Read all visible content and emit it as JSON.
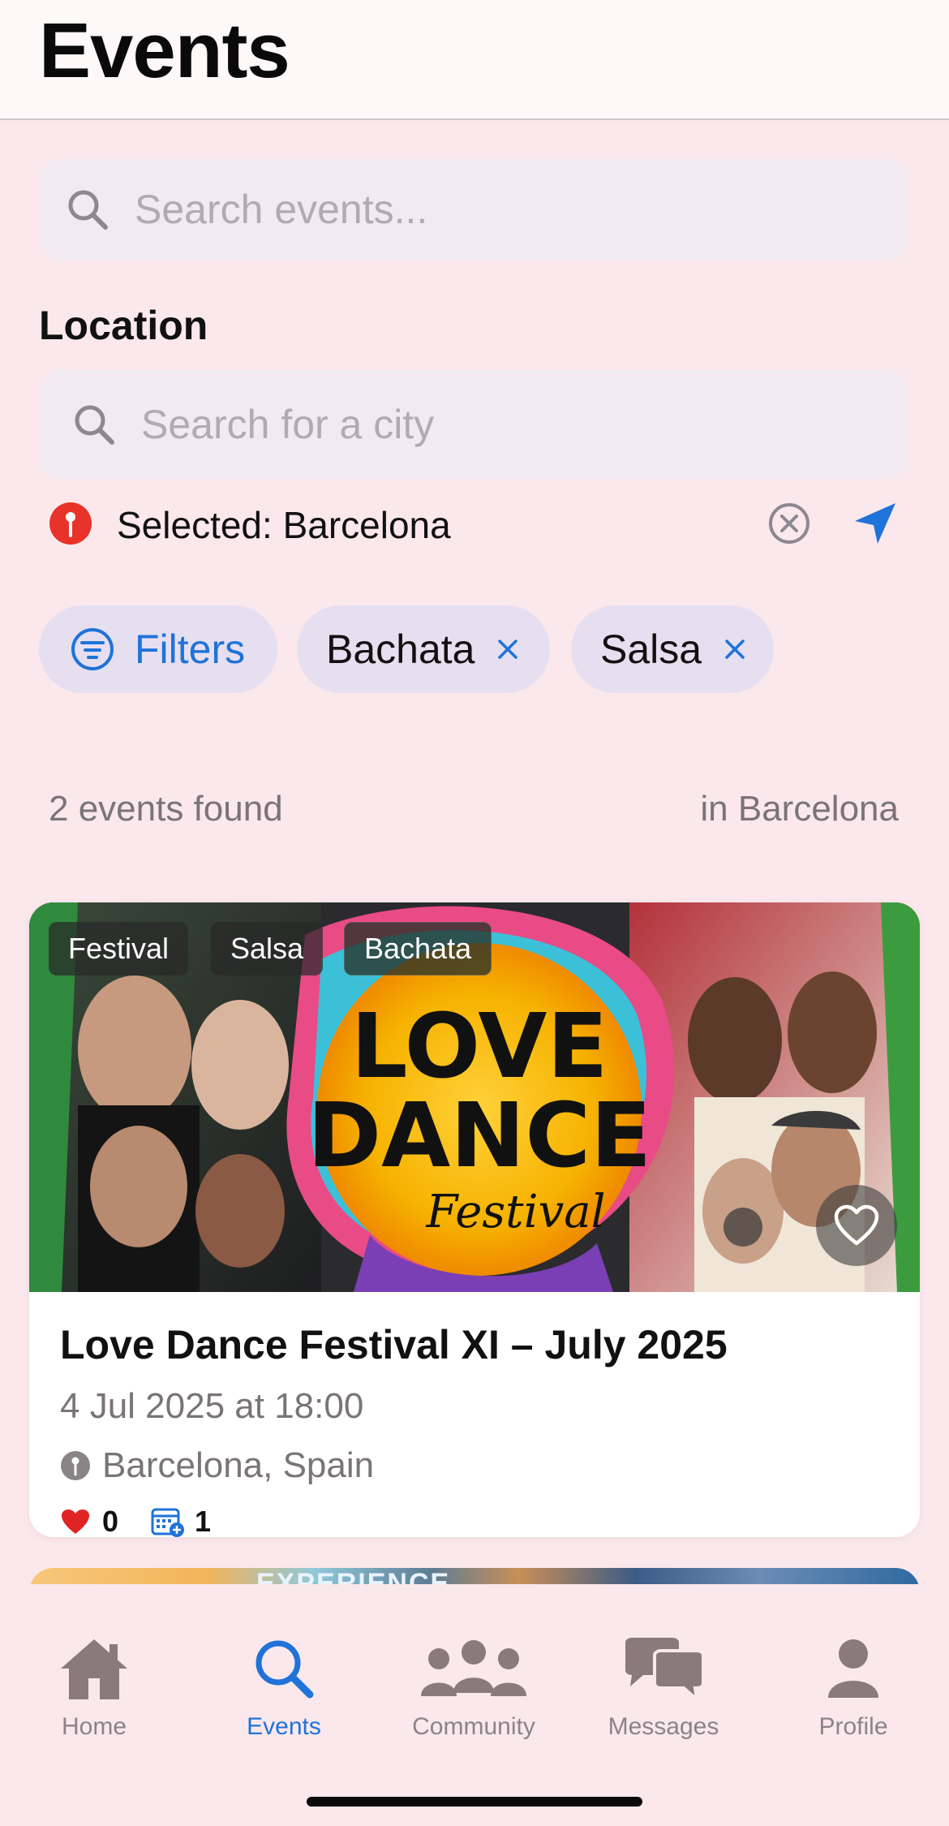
{
  "header": {
    "title": "Events"
  },
  "search": {
    "placeholder": "Search events..."
  },
  "location": {
    "section_label": "Location",
    "city_placeholder": "Search for a city",
    "selected_text": "Selected: Barcelona"
  },
  "filters": {
    "filters_label": "Filters",
    "chips": [
      {
        "label": "Bachata"
      },
      {
        "label": "Salsa"
      }
    ]
  },
  "results": {
    "count_text": "2 events found",
    "location_text": "in Barcelona"
  },
  "event_card": {
    "tags": [
      "Festival",
      "Salsa",
      "Bachata"
    ],
    "image_text": {
      "line1": "LOVE",
      "line2": "DANCE",
      "line3": "Festival"
    },
    "title": "Love Dance Festival XI – July 2025",
    "datetime": "4 Jul 2025 at 18:00",
    "location": "Barcelona, Spain",
    "likes": "0",
    "calendar_adds": "1"
  },
  "next_card": {
    "visible_text": "EXPERIENCE"
  },
  "tabbar": {
    "items": [
      {
        "label": "Home",
        "icon": "home-icon"
      },
      {
        "label": "Events",
        "icon": "search-icon",
        "active": true
      },
      {
        "label": "Community",
        "icon": "people-icon"
      },
      {
        "label": "Messages",
        "icon": "chat-bubbles-icon"
      },
      {
        "label": "Profile",
        "icon": "person-icon"
      }
    ]
  },
  "colors": {
    "accent": "#1f73d9",
    "background": "#fbe8ec",
    "pin_red": "#e8332a",
    "heart_red": "#e02424"
  }
}
